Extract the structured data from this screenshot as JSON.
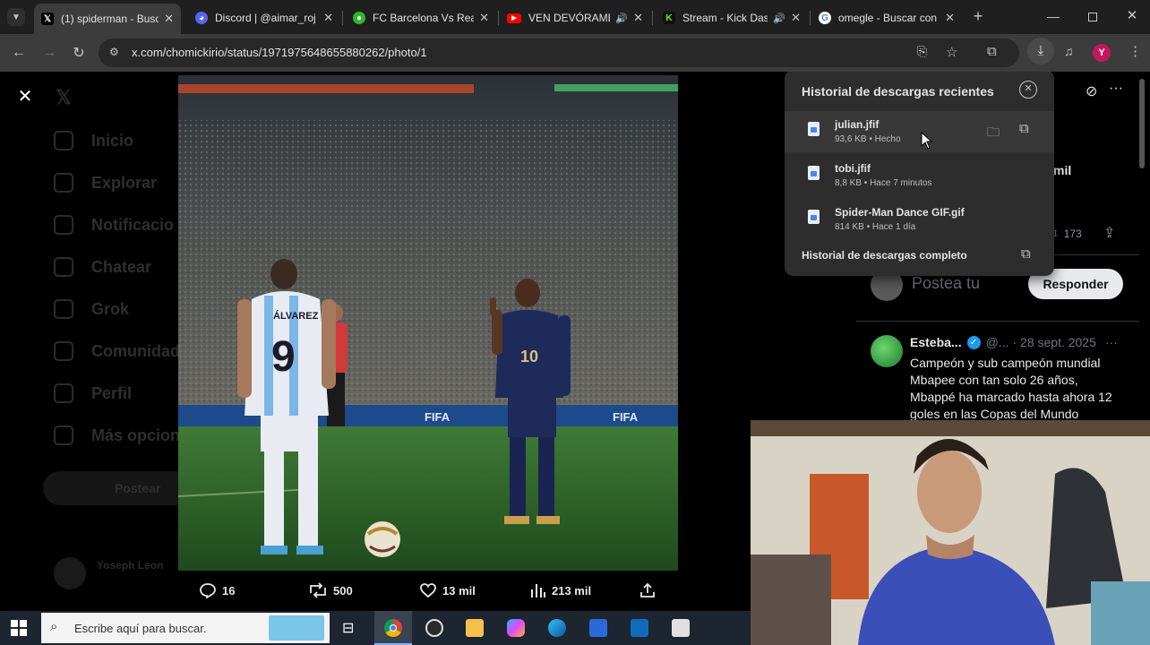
{
  "browser": {
    "tabs": [
      {
        "title": "(1) spiderman - Buscar",
        "favicon": "x-logo-icon",
        "color": "#000000",
        "active": true
      },
      {
        "title": "Discord | @aimar_roj",
        "favicon": "discord-icon",
        "color": "#5865f2",
        "active": false
      },
      {
        "title": "FC Barcelona Vs Real",
        "favicon": "football-icon",
        "color": "#2eb82e",
        "active": false
      },
      {
        "title": "VEN DEVÓRAME",
        "favicon": "youtube-icon",
        "color": "#ff0000",
        "active": false,
        "audio": true
      },
      {
        "title": "Stream - Kick Das",
        "favicon": "kick-icon",
        "color": "#53fc18",
        "active": false,
        "audio": true
      },
      {
        "title": "omegle - Buscar con",
        "favicon": "google-icon",
        "color": "#4285f4",
        "active": false
      }
    ],
    "url": "x.com/chomickirio/status/1971975648655880262/photo/1",
    "avatar_letter": "Y"
  },
  "sidebar_dim": {
    "items": [
      "Inicio",
      "Explorar",
      "Notificacio",
      "Chatear",
      "Grok",
      "Comunidad",
      "Perfil",
      "Más opcion"
    ],
    "post_button": "Postear",
    "user_name": "Yoseph Leon"
  },
  "downloads": {
    "title": "Historial de descargas recientes",
    "items": [
      {
        "name": "julian.jfif",
        "meta": "93,6 KB • Hecho"
      },
      {
        "name": "tobi.jfif",
        "meta": "8,8 KB • Hace 7 minutos"
      },
      {
        "name": "Spider-Man Dance GIF.gif",
        "meta": "814 KB • Hace 1 día"
      }
    ],
    "full_history": "Historial de descargas completo"
  },
  "right_panel": {
    "partial_word": "mil",
    "bookmark_count": "173",
    "reply_placeholder": "Postea tu",
    "reply_button": "Responder",
    "reply": {
      "author": "Esteba...",
      "handle": "@...",
      "date": "· 28 sept. 2025",
      "text": [
        "Campeón y sub campeón mundial",
        "Mbapee con tan solo 26 años,",
        "Mbappé ha marcado hasta ahora 12",
        "goles en las Copas del Mundo"
      ]
    }
  },
  "photo": {
    "jersey_left_name": "ÁLVAREZ",
    "jersey_left_number": "9",
    "jersey_right_number": "10",
    "board_text": "FIFA"
  },
  "actions": {
    "replies": "16",
    "reposts": "500",
    "likes": "13 mil",
    "views": "213 mil"
  },
  "taskbar": {
    "search_placeholder": "Escribe aquí para buscar."
  },
  "colors": {
    "accent_blue": "#1d9bf0",
    "panel": "#2d2d2d",
    "verified": "#1d9bf0"
  }
}
